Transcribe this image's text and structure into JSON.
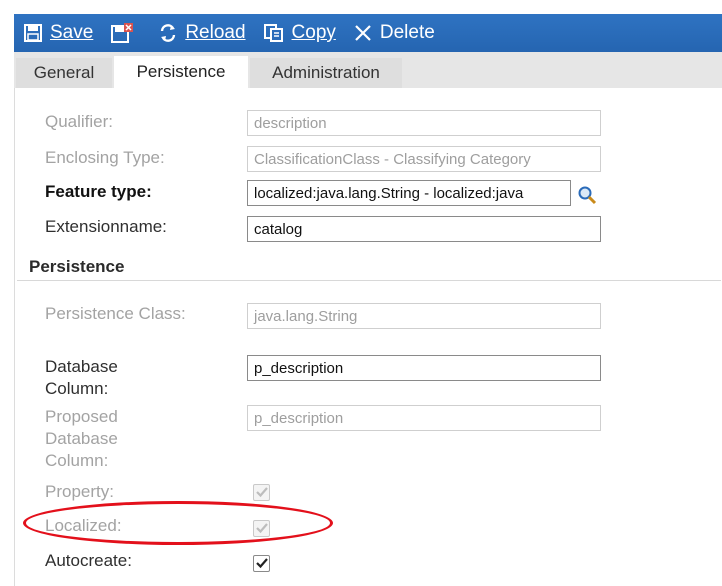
{
  "toolbar": {
    "save_label": "Save",
    "reload_label": "Reload",
    "copy_label": "Copy",
    "delete_label": "Delete"
  },
  "tabs": {
    "general": "General",
    "persistence": "Persistence",
    "administration": "Administration",
    "active": "Persistence"
  },
  "form": {
    "qualifier": {
      "label": "Qualifier:",
      "value": "description"
    },
    "enclosing_type": {
      "label": "Enclosing Type:",
      "value": "ClassificationClass - Classifying Category"
    },
    "feature_type": {
      "label": "Feature type:",
      "value": "localized:java.lang.String - localized:java"
    },
    "extensionname": {
      "label": "Extensionname:",
      "value": "catalog"
    }
  },
  "persistence": {
    "section_title": "Persistence",
    "persistence_class": {
      "label": "Persistence Class:",
      "value": "java.lang.String"
    },
    "database_column": {
      "label": "Database Column:",
      "value": "p_description"
    },
    "proposed_database_column": {
      "label": "Proposed Database Column:",
      "value": "p_description"
    },
    "property": {
      "label": "Property:",
      "checked": true
    },
    "localized": {
      "label": "Localized:",
      "checked": true
    },
    "autocreate": {
      "label": "Autocreate:",
      "checked": true
    }
  },
  "colors": {
    "toolbar_bg": "#2a6bb9",
    "annotation": "#e3101b"
  },
  "icons": [
    "save-icon",
    "file-icon",
    "reload-icon",
    "copy-icon",
    "delete-icon",
    "search-icon",
    "check-icon"
  ]
}
